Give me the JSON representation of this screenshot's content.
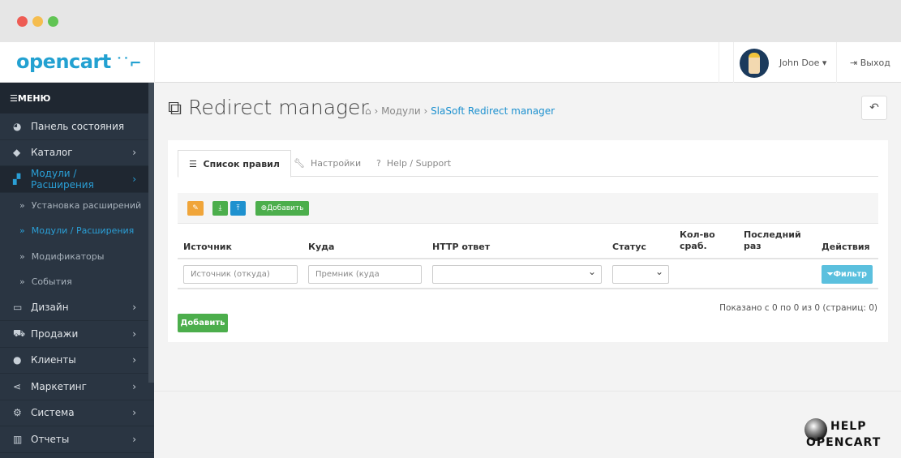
{
  "window": {
    "dots": [
      "#ee5c54",
      "#f5bd4f",
      "#61c454"
    ]
  },
  "header": {
    "logo": "opencart",
    "logo_cart": "⊸",
    "user_name": "John Doe",
    "logout": "Выход"
  },
  "sidebar": {
    "menu_label": "МЕНЮ",
    "items": [
      {
        "label": "Панель состояния",
        "icon": "dashboard-icon",
        "glyph": "◕",
        "chev": false
      },
      {
        "label": "Каталог",
        "icon": "tags-icon",
        "glyph": "◆",
        "chev": true
      },
      {
        "label": "Модули / Расширения",
        "icon": "puzzle-icon",
        "glyph": "▞",
        "chev": true,
        "active": true
      }
    ],
    "subitems": [
      {
        "label": "Установка расширений"
      },
      {
        "label": "Модули / Расширения",
        "active": true
      },
      {
        "label": "Модификаторы"
      },
      {
        "label": "События"
      }
    ],
    "items2": [
      {
        "label": "Дизайн",
        "icon": "desktop-icon",
        "glyph": "▭"
      },
      {
        "label": "Продажи",
        "icon": "cart-icon",
        "glyph": "⛟"
      },
      {
        "label": "Клиенты",
        "icon": "user-icon",
        "glyph": "●"
      },
      {
        "label": "Маркетинг",
        "icon": "share-icon",
        "glyph": "⋖"
      },
      {
        "label": "Система",
        "icon": "cog-icon",
        "glyph": "⚙"
      },
      {
        "label": "Отчеты",
        "icon": "bar-chart-icon",
        "glyph": "▥"
      }
    ]
  },
  "page": {
    "title": "Redirect manager",
    "breadcrumb": [
      "Модули",
      "SlaSoft Redirect manager"
    ]
  },
  "tabs": [
    "Список правил",
    "Настройки",
    "Help / Support"
  ],
  "toolbar": {
    "add": "Добавить"
  },
  "table": {
    "headers": [
      "Источник",
      "Куда",
      "HTTP ответ",
      "Статус",
      "Кол-во сраб.",
      "Последний раз",
      "Действия"
    ],
    "filters": {
      "source_placeholder": "Источник (откуда)",
      "target_placeholder": "Премник (куда",
      "http": "",
      "status": ""
    },
    "filter_button": "Фильтр"
  },
  "pagination": "Показано с 0 по 0 из 0 (страниц: 0)",
  "add_button": "Добавить",
  "watermark": [
    "HELP",
    "OPENCART"
  ]
}
